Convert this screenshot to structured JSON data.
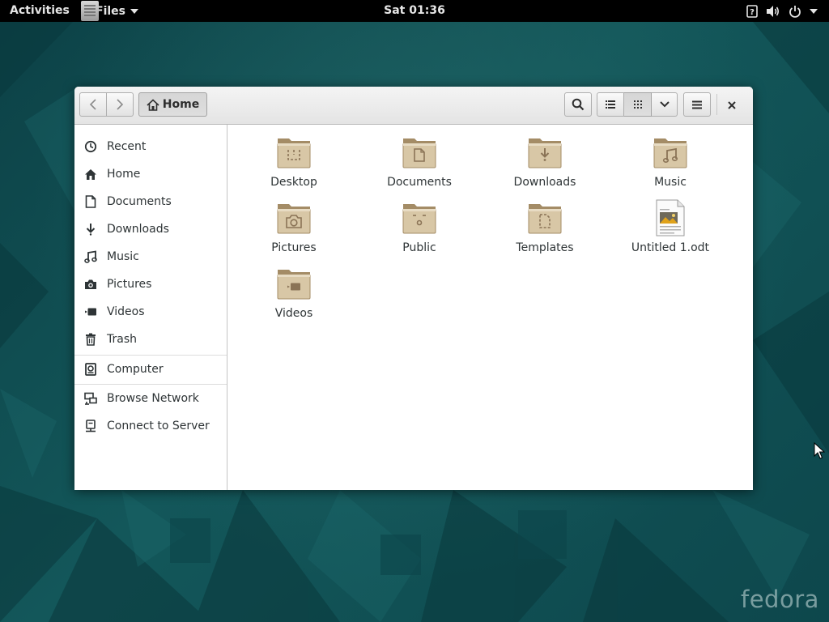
{
  "topbar": {
    "activities": "Activities",
    "app_menu_label": "Files",
    "clock": "Sat 01:36",
    "status_icons": [
      "accessibility-icon",
      "volume-icon",
      "power-icon",
      "chevron-down-icon"
    ]
  },
  "headerbar": {
    "back_icon": "chevron-left-icon",
    "forward_icon": "chevron-right-icon",
    "location_label": "Home",
    "search_icon": "search-icon",
    "list_view_icon": "list-icon",
    "grid_view_icon": "grid-icon",
    "view_options_icon": "chevron-down-icon",
    "menu_icon": "hamburger-icon",
    "close_icon": "close-icon"
  },
  "sidebar": {
    "places": [
      {
        "label": "Recent",
        "icon": "clock-icon"
      },
      {
        "label": "Home",
        "icon": "home-icon"
      },
      {
        "label": "Documents",
        "icon": "document-icon"
      },
      {
        "label": "Downloads",
        "icon": "download-icon"
      },
      {
        "label": "Music",
        "icon": "music-icon"
      },
      {
        "label": "Pictures",
        "icon": "camera-icon"
      },
      {
        "label": "Videos",
        "icon": "video-icon"
      },
      {
        "label": "Trash",
        "icon": "trash-icon"
      }
    ],
    "devices": [
      {
        "label": "Computer",
        "icon": "computer-icon"
      }
    ],
    "network": [
      {
        "label": "Browse Network",
        "icon": "network-icon"
      },
      {
        "label": "Connect to Server",
        "icon": "server-icon"
      }
    ]
  },
  "files": [
    {
      "name": "Desktop",
      "type": "folder",
      "emblem": "desktop"
    },
    {
      "name": "Documents",
      "type": "folder",
      "emblem": "documents"
    },
    {
      "name": "Downloads",
      "type": "folder",
      "emblem": "downloads"
    },
    {
      "name": "Music",
      "type": "folder",
      "emblem": "music"
    },
    {
      "name": "Pictures",
      "type": "folder",
      "emblem": "pictures"
    },
    {
      "name": "Public",
      "type": "folder",
      "emblem": "public"
    },
    {
      "name": "Templates",
      "type": "folder",
      "emblem": "templates"
    },
    {
      "name": "Untitled 1.odt",
      "type": "document",
      "emblem": "odt"
    },
    {
      "name": "Videos",
      "type": "folder",
      "emblem": "videos"
    }
  ],
  "watermark": "fedora",
  "colors": {
    "folder_body": "#d8c7a6",
    "folder_dark": "#b39a72",
    "emblem": "#8a7356",
    "topbar": "#000000",
    "desktop": "#0f4a4e"
  }
}
